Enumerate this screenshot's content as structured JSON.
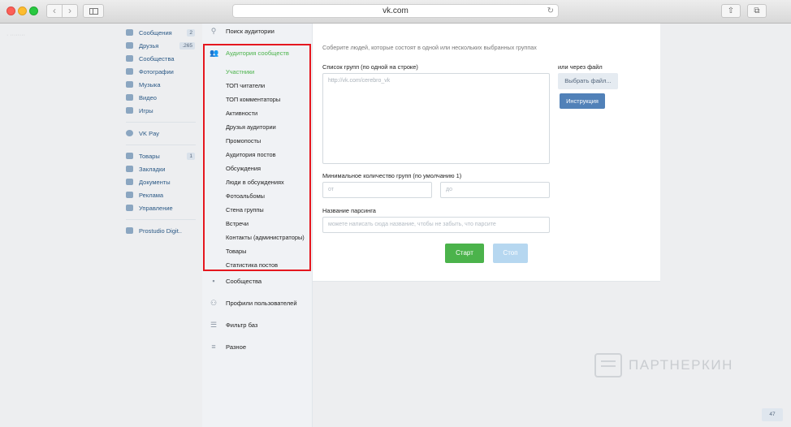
{
  "browser": {
    "url": "vk.com"
  },
  "vk_menu": {
    "items": [
      {
        "label": "Сообщения",
        "badge": "2",
        "icon": "message-icon"
      },
      {
        "label": "Друзья",
        "badge": ".265",
        "icon": "friends-icon"
      },
      {
        "label": "Сообщества",
        "badge": "",
        "icon": "communities-icon"
      },
      {
        "label": "Фотографии",
        "badge": "",
        "icon": "photos-icon"
      },
      {
        "label": "Музыка",
        "badge": "",
        "icon": "music-icon"
      },
      {
        "label": "Видео",
        "badge": "",
        "icon": "video-icon"
      },
      {
        "label": "Игры",
        "badge": "",
        "icon": "games-icon"
      }
    ],
    "pay": {
      "label": "VK Pay",
      "icon": "vk-pay-icon"
    },
    "items2": [
      {
        "label": "Товары",
        "badge": "1",
        "icon": "goods-icon"
      },
      {
        "label": "Закладки",
        "badge": "",
        "icon": "bookmarks-icon"
      },
      {
        "label": "Документы",
        "badge": "",
        "icon": "documents-icon"
      },
      {
        "label": "Реклама",
        "badge": "",
        "icon": "ads-icon"
      },
      {
        "label": "Управление",
        "badge": "",
        "icon": "manage-icon"
      }
    ],
    "group": {
      "label": "Prostudio Digit..",
      "icon": "group-icon"
    }
  },
  "app_panel": {
    "search": "Поиск аудитории",
    "active_group": "Аудитория сообществ",
    "sub_items": [
      "Участники",
      "ТОП читатели",
      "ТОП комментаторы",
      "Активности",
      "Друзья аудитории",
      "Промопосты",
      "Аудитория постов",
      "Обсуждения",
      "Люди в обсуждениях",
      "Фотоальбомы",
      "Стена группы",
      "Встречи",
      "Контакты (администраторы)",
      "Товары",
      "Статистика постов"
    ],
    "other_groups": [
      "Сообщества",
      "Профили пользователей",
      "Фильтр баз",
      "Разное"
    ]
  },
  "form": {
    "lead": "Соберите людей, которые состоят в одной или нескольких выбранных группах",
    "list_label": "Список групп (по одной на строке)",
    "list_placeholder": "http://vk.com/cerebro_vk",
    "file_label": "или через файл",
    "file_button": "Выбрать файл...",
    "instruction_button": "Инструкция",
    "min_groups_label": "Минимальное количество групп (по умолчанию 1)",
    "from_placeholder": "от",
    "to_placeholder": "до",
    "parsing_name_label": "Название парсинга",
    "parsing_name_placeholder": "можете написать сюда название, чтобы не забыть, что парсите",
    "start_button": "Старт",
    "stop_button": "Стоп"
  },
  "watermark": "ПАРТНЕРКИН",
  "footer_badge": "47"
}
